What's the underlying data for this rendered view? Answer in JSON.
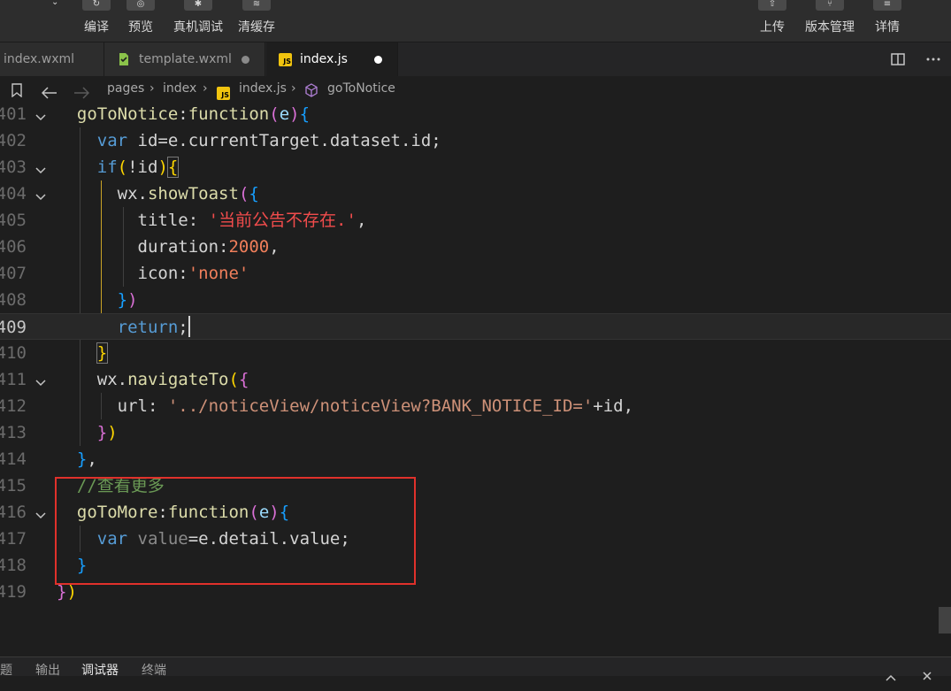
{
  "toolbar": {
    "left_buttons": [
      "编译",
      "预览",
      "真机调试",
      "清缓存"
    ],
    "right_buttons": [
      "上传",
      "版本管理",
      "详情"
    ]
  },
  "tabs": [
    {
      "label": "index.wxml",
      "icon": "xml-file-icon",
      "active": false
    },
    {
      "label": "template.wxml",
      "icon": "wxml-file-icon",
      "active": false,
      "dot": "modified-dot"
    },
    {
      "label": "index.js",
      "icon": "js-file-icon",
      "icon_text": "JS",
      "active": true,
      "dot": "unsaved-dot"
    }
  ],
  "tab_actions": [
    "split-editor-icon",
    "more-actions-icon"
  ],
  "breadcrumb": {
    "items": [
      "pages",
      "index",
      "index.js",
      "goToNotice"
    ]
  },
  "editor": {
    "current_line": "409",
    "lines": [
      {
        "n": "401",
        "fold": true
      },
      {
        "n": "402",
        "fold": false
      },
      {
        "n": "403",
        "fold": true
      },
      {
        "n": "404",
        "fold": true
      },
      {
        "n": "405",
        "fold": false
      },
      {
        "n": "406",
        "fold": false
      },
      {
        "n": "407",
        "fold": false
      },
      {
        "n": "408",
        "fold": false
      },
      {
        "n": "409",
        "fold": false
      },
      {
        "n": "410",
        "fold": false
      },
      {
        "n": "411",
        "fold": true
      },
      {
        "n": "412",
        "fold": false
      },
      {
        "n": "413",
        "fold": false
      },
      {
        "n": "414",
        "fold": false
      },
      {
        "n": "415",
        "fold": false
      },
      {
        "n": "416",
        "fold": true
      },
      {
        "n": "417",
        "fold": false
      },
      {
        "n": "418",
        "fold": false
      },
      {
        "n": "419",
        "fold": false
      }
    ],
    "code": {
      "l401": {
        "name": "goToNotice",
        "colon": ":",
        "kw": "function",
        "p1": "(",
        "arg": "e",
        "p2": ")",
        "brace": "{"
      },
      "l402": {
        "kw": "var",
        "rest": " id=e.currentTarget.dataset.id;"
      },
      "l403": {
        "kw": "if",
        "p": "(",
        "rest": "!id",
        "p2": ")",
        "brace": "{"
      },
      "l404": {
        "obj": "wx",
        "dot": ".",
        "fn": "showToast",
        "p": "(",
        "brace": "{"
      },
      "l405": {
        "key": "title",
        "colon": ": ",
        "str": "'当前公告不存在.'",
        "comma": ","
      },
      "l406": {
        "key": "duration",
        "colon": ":",
        "num": "2000",
        "comma": ","
      },
      "l407": {
        "key": "icon",
        "colon": ":",
        "str": "'none'"
      },
      "l408": {
        "brace": "}",
        "p": ")"
      },
      "l409": {
        "kw": "return",
        "semi": ";"
      },
      "l410": {
        "brace": "}"
      },
      "l411": {
        "obj": "wx",
        "dot": ".",
        "fn": "navigateTo",
        "p": "(",
        "brace": "{"
      },
      "l412": {
        "key": "url",
        "colon": ": ",
        "str": "'../noticeView/noticeView?BANK_NOTICE_ID='",
        "rest": "+id,"
      },
      "l413": {
        "brace": "}",
        "p": ")"
      },
      "l414": {
        "brace": "}",
        "comma": ","
      },
      "l415": {
        "comment": "//查看更多"
      },
      "l416": {
        "name": "goToMore",
        "colon": ":",
        "kw": "function",
        "p1": "(",
        "arg": "e",
        "p2": ")",
        "brace": "{"
      },
      "l417": {
        "kw": "var",
        "unused": " value",
        "rest": "=e.detail.value;"
      },
      "l418": {
        "brace": "}"
      },
      "l419": {
        "brace": "}",
        "p": ")"
      }
    }
  },
  "bottom_panel": {
    "tabs": [
      "问题",
      "输出",
      "调试器",
      "终端"
    ],
    "active": "调试器"
  },
  "colors": {
    "background": "#1e1e1e",
    "keyword": "#569cd6",
    "function": "#dcdcaa",
    "string": "#ce9178",
    "number": "#b5cea8",
    "comment": "#6a9955",
    "highlight_box": "#e0312b"
  }
}
